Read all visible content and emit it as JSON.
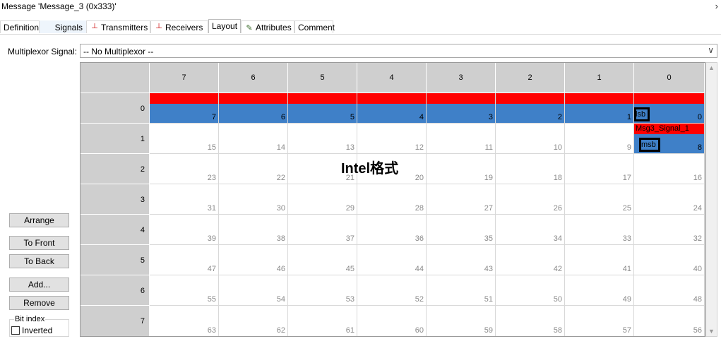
{
  "window": {
    "title": "Message 'Message_3 (0x333)'"
  },
  "tabs": [
    {
      "label": "Definition",
      "icon": ""
    },
    {
      "label": "Signals",
      "icon": ""
    },
    {
      "label": "Transmitters",
      "icon": "transmitter-icon"
    },
    {
      "label": "Receivers",
      "icon": "receiver-icon"
    },
    {
      "label": "Layout",
      "icon": "",
      "active": true
    },
    {
      "label": "Attributes",
      "icon": "pencil-icon"
    },
    {
      "label": "Comment",
      "icon": ""
    }
  ],
  "mux": {
    "label": "Multiplexor Signal:",
    "value": "-- No Multiplexor --"
  },
  "grid": {
    "col_headers": [
      "7",
      "6",
      "5",
      "4",
      "3",
      "2",
      "1",
      "0"
    ],
    "row_headers": [
      "0",
      "1",
      "2",
      "3",
      "4",
      "5",
      "6",
      "7"
    ],
    "bits": [
      [
        "7",
        "6",
        "5",
        "4",
        "3",
        "2",
        "1",
        "0"
      ],
      [
        "15",
        "14",
        "13",
        "12",
        "11",
        "10",
        "9",
        "8"
      ],
      [
        "23",
        "22",
        "21",
        "20",
        "19",
        "18",
        "17",
        "16"
      ],
      [
        "31",
        "30",
        "29",
        "28",
        "27",
        "26",
        "25",
        "24"
      ],
      [
        "39",
        "38",
        "37",
        "36",
        "35",
        "34",
        "33",
        "32"
      ],
      [
        "47",
        "46",
        "45",
        "44",
        "43",
        "42",
        "41",
        "40"
      ],
      [
        "55",
        "54",
        "53",
        "52",
        "51",
        "50",
        "49",
        "48"
      ],
      [
        "63",
        "62",
        "61",
        "60",
        "59",
        "58",
        "57",
        "56"
      ]
    ],
    "signal_name": "Msg3_Signal_1",
    "lsb_label": "lsb",
    "msb_label": "msb",
    "annotation": "Intel格式",
    "colors": {
      "signal_bar": "#ff0000",
      "signal_bits": "#3f80c8",
      "header": "#cfcfcf"
    }
  },
  "buttons": {
    "arrange": "Arrange",
    "to_front": "To Front",
    "to_back": "To Back",
    "add": "Add...",
    "remove": "Remove"
  },
  "bit_index": {
    "legend": "Bit index",
    "inverted_label": "Inverted",
    "inverted_checked": false
  }
}
